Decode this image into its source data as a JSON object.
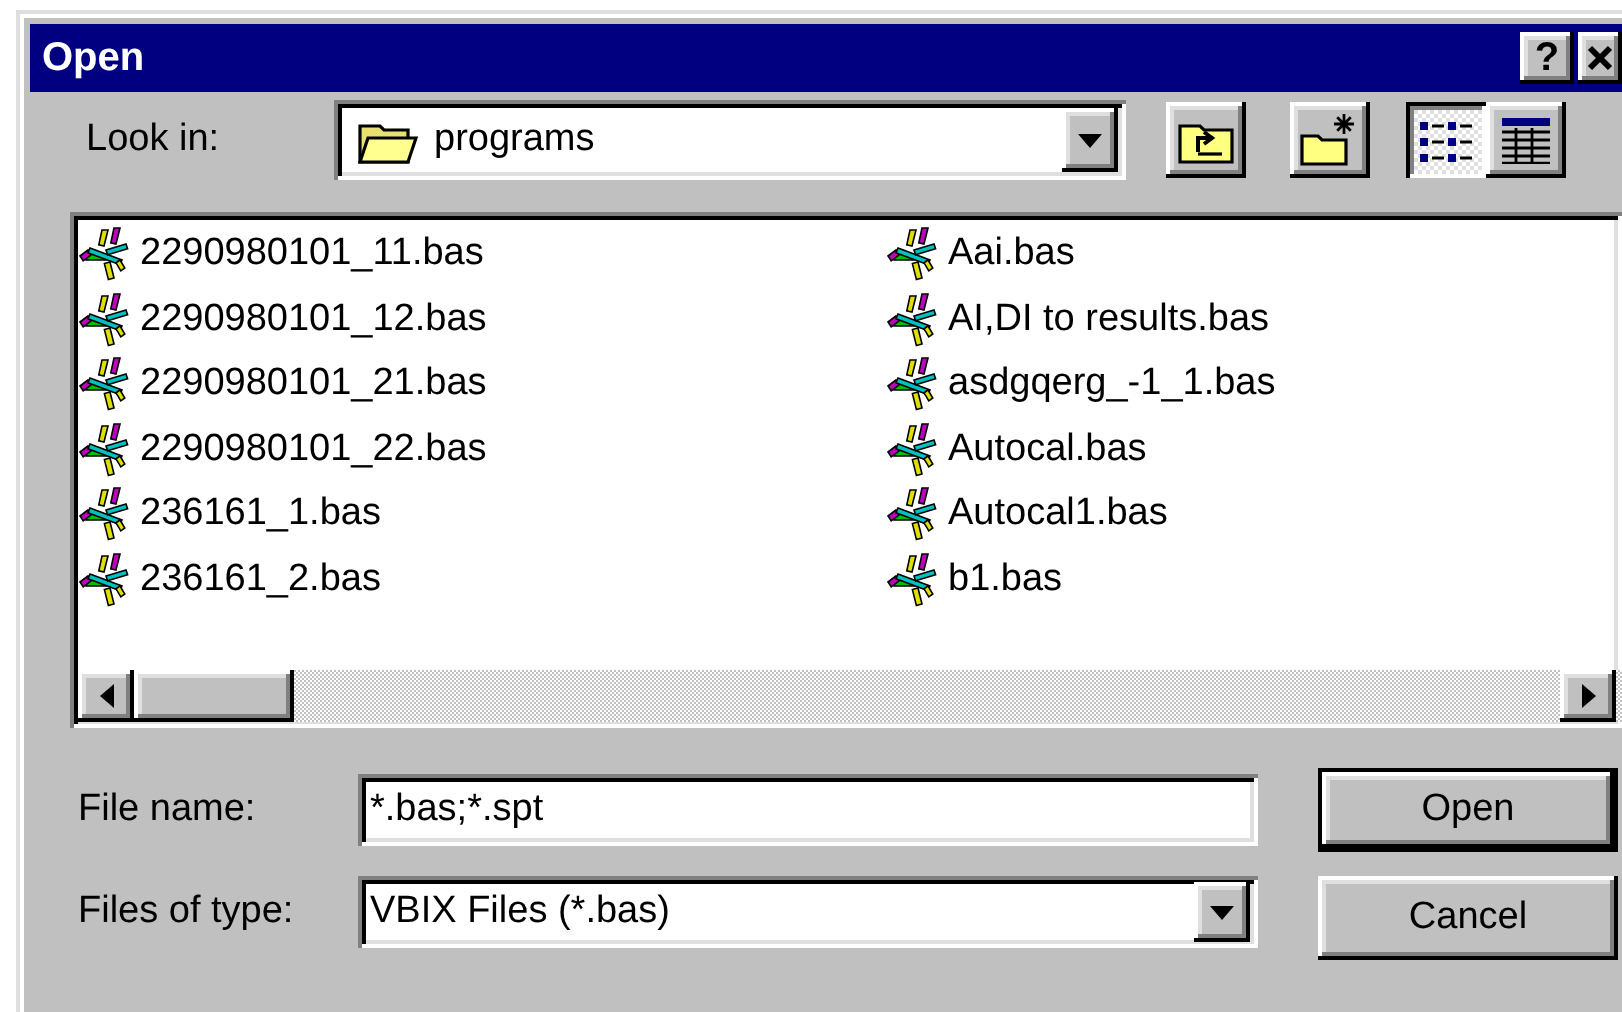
{
  "window": {
    "title": "Open",
    "help": "?"
  },
  "look_in": {
    "label": "Look in:",
    "value": "programs"
  },
  "toolbar": [
    {
      "kind": "up-folder"
    },
    {
      "kind": "new-folder"
    }
  ],
  "view_buttons": [
    {
      "kind": "list",
      "selected": true
    },
    {
      "kind": "details",
      "selected": false
    }
  ],
  "files": [
    {
      "name": "2290980101_11.bas"
    },
    {
      "name": "2290980101_12.bas"
    },
    {
      "name": "2290980101_21.bas"
    },
    {
      "name": "2290980101_22.bas"
    },
    {
      "name": "236161_1.bas"
    },
    {
      "name": "236161_2.bas"
    },
    {
      "name": "Aai.bas"
    },
    {
      "name": "AI,DI to results.bas"
    },
    {
      "name": "asdgqerg_-1_1.bas"
    },
    {
      "name": "Autocal.bas"
    },
    {
      "name": "Autocal1.bas"
    },
    {
      "name": "b1.bas"
    }
  ],
  "file_name": {
    "label": "File name:",
    "value": "*.bas;*.spt"
  },
  "file_type": {
    "label": "Files of type:",
    "value": "VBIX Files (*.bas)"
  },
  "buttons": [
    {
      "label": "Open",
      "default": true
    },
    {
      "label": "Cancel",
      "default": false
    }
  ]
}
